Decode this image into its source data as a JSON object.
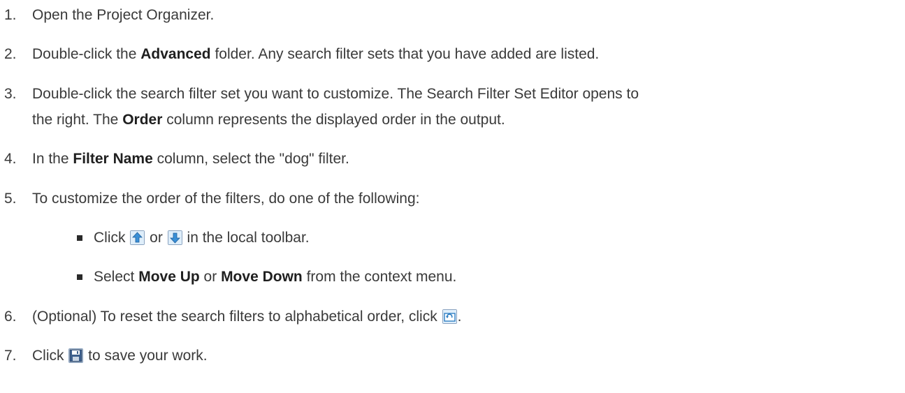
{
  "steps": [
    {
      "num": "1.",
      "parts": [
        "Open the Project Organizer."
      ]
    },
    {
      "num": "2.",
      "pre": "Double-click the ",
      "bold": "Advanced",
      "post": " folder. Any search filter sets that you have added are listed."
    },
    {
      "num": "3.",
      "line1": "Double-click the search filter set you want to customize. The Search Filter Set Editor opens to",
      "line2_pre": "the right. The ",
      "line2_bold": "Order",
      "line2_post": " column represents the displayed order in the output."
    },
    {
      "num": "4.",
      "pre": "In the ",
      "bold": "Filter Name",
      "post": " column, select the \"dog\" filter."
    },
    {
      "num": "5.",
      "text": "To customize the order of the filters, do one of the following:"
    },
    {
      "num": "6.",
      "pre": "(Optional) To reset the search filters to alphabetical order, click ",
      "post": "."
    },
    {
      "num": "7.",
      "pre": "Click ",
      "post": " to save your work."
    }
  ],
  "bullets": [
    {
      "pre": "Click ",
      "mid": " or ",
      "post": " in the local toolbar."
    },
    {
      "pre": "Select ",
      "bold1": "Move Up",
      "mid": " or ",
      "bold2": "Move Down",
      "post": " from the context menu."
    }
  ],
  "icons": {
    "move_up": "move-up-icon",
    "move_down": "move-down-icon",
    "reset": "reset-order-icon",
    "save": "save-icon"
  }
}
